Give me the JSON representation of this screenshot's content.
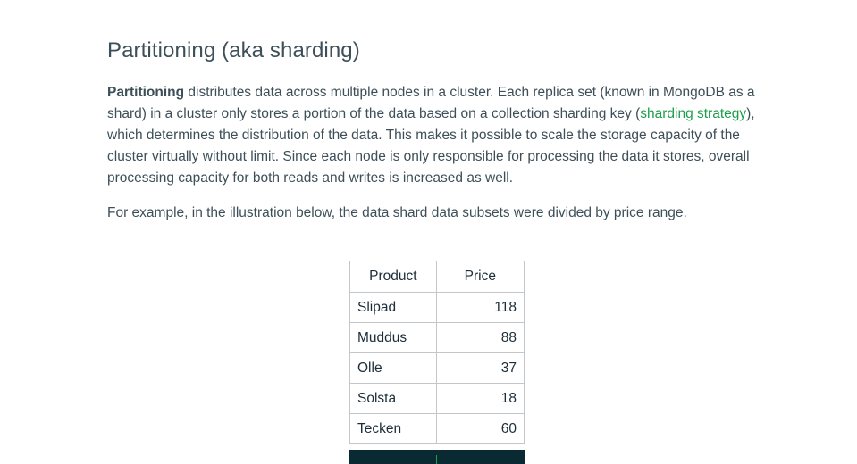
{
  "article": {
    "heading": "Partitioning (aka sharding)",
    "paragraph1": {
      "bold_lead": "Partitioning",
      "text_before_link": " distributes data across multiple nodes in a cluster. Each replica set (known in MongoDB as a shard) in a cluster only stores a portion of the data based on a collection sharding key (",
      "link_text": "sharding strategy",
      "text_after_link": "), which determines the distribution of the data. This makes it possible to scale the storage capacity of the cluster virtually without limit. Since each node is only responsible for processing the data it stores, overall processing capacity for both reads and writes is increased as well."
    },
    "paragraph2": "For example, in the illustration below, the data shard data subsets were divided by price range."
  },
  "table": {
    "headers": [
      "Product",
      "Price"
    ],
    "rows": [
      {
        "product": "Slipad",
        "price": "118"
      },
      {
        "product": "Muddus",
        "price": "88"
      },
      {
        "product": "Olle",
        "price": "37"
      },
      {
        "product": "Solsta",
        "price": "18"
      },
      {
        "product": "Tecken",
        "price": "60"
      }
    ]
  },
  "colors": {
    "text": "#3d4f58",
    "link": "#1a9f4a",
    "table_border": "#c3c7c9",
    "dark_bar": "#0a2a33"
  }
}
